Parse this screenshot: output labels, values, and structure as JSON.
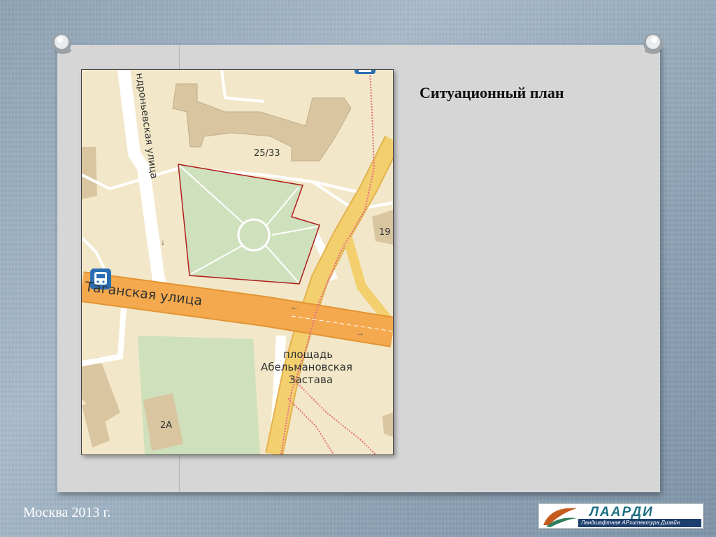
{
  "slide": {
    "title": "Ситуационный план",
    "footer": "Москва 2013 г."
  },
  "logo": {
    "name": "ЛААРДИ",
    "tagline": "Ландшафтная АРхитектура Дизайн"
  },
  "map": {
    "labels": {
      "street_andronyevskaya": "ндроньевская улица",
      "street_taganskaya": "Таганская улица",
      "square_line1": "площадь",
      "square_line2": "Абельмановская",
      "square_line3": "Застава",
      "building_1": "25/33",
      "building_2": "19",
      "building_3": "2А"
    },
    "icons": [
      "bus-stop-icon",
      "bus-stop-icon"
    ],
    "colors": {
      "land": "#f2e8c9",
      "park": "#cfe0bd",
      "building": "#d9c6a1",
      "main_road": "#f4a94e",
      "secondary_road": "#f3cf6e",
      "tram": "#e66b86",
      "site_outline": "#b01c1c"
    }
  }
}
